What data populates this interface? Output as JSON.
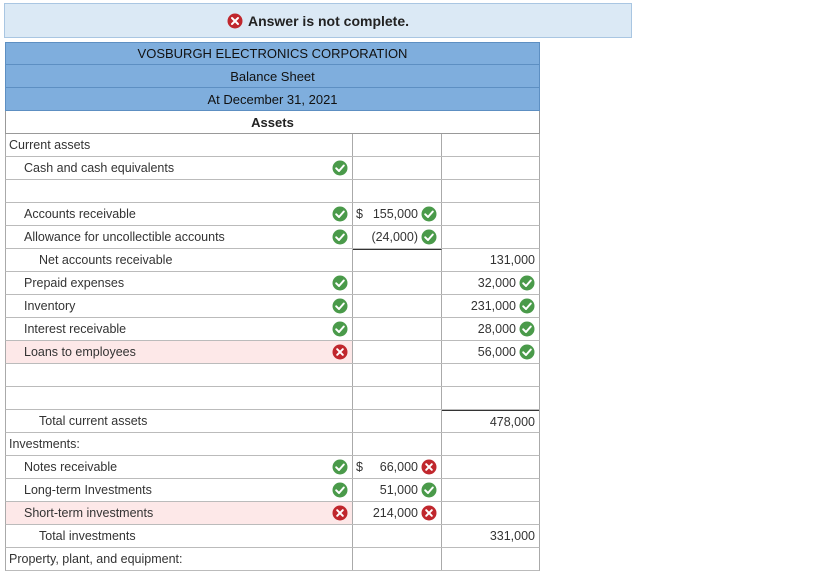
{
  "banner": {
    "text": "Answer is not complete.",
    "icon": "x-circle-icon"
  },
  "header": {
    "company": "VOSBURGH ELECTRONICS CORPORATION",
    "statement": "Balance Sheet",
    "date": "At December 31, 2021",
    "section": "Assets"
  },
  "rows": [
    {
      "label": "Current assets",
      "indent": 0
    },
    {
      "label": "Cash and cash equivalents",
      "indent": 1,
      "status": "correct"
    },
    {
      "label": "",
      "indent": 1
    },
    {
      "label": "Accounts receivable",
      "indent": 1,
      "status": "correct",
      "dollar": "$",
      "col2": "155,000",
      "col2_status": "correct"
    },
    {
      "label": "Allowance for uncollectible accounts",
      "indent": 1,
      "status": "correct",
      "col2": "(24,000)",
      "col2_status": "correct"
    },
    {
      "label": "Net accounts receivable",
      "indent": 2,
      "col3": "131,000"
    },
    {
      "label": "Prepaid expenses",
      "indent": 1,
      "status": "correct",
      "col3": "32,000",
      "col3_status": "correct"
    },
    {
      "label": "Inventory",
      "indent": 1,
      "status": "correct",
      "col3": "231,000",
      "col3_status": "correct"
    },
    {
      "label": "Interest receivable",
      "indent": 1,
      "status": "correct",
      "col3": "28,000",
      "col3_status": "correct"
    },
    {
      "label": "Loans to employees",
      "indent": 1,
      "status": "incorrect",
      "col3": "56,000",
      "col3_status": "correct"
    },
    {
      "label": "",
      "indent": 1
    },
    {
      "label": "",
      "indent": 1
    },
    {
      "label": "Total current assets",
      "indent": 2,
      "col3": "478,000"
    },
    {
      "label": "Investments:",
      "indent": 0
    },
    {
      "label": "Notes receivable",
      "indent": 1,
      "status": "correct",
      "dollar": "$",
      "col2": "66,000",
      "col2_status": "incorrect"
    },
    {
      "label": "Long-term Investments",
      "indent": 1,
      "status": "correct",
      "col2": "51,000",
      "col2_status": "correct"
    },
    {
      "label": "Short-term investments",
      "indent": 1,
      "status": "incorrect",
      "col2": "214,000",
      "col2_status": "incorrect"
    },
    {
      "label": "Total investments",
      "indent": 2,
      "col3": "331,000"
    },
    {
      "label": "Property, plant, and equipment:",
      "indent": 0
    }
  ],
  "colors": {
    "correct": "#4a9a4a",
    "incorrect": "#c0272d",
    "header_bg": "#7faedd",
    "banner_bg": "#dbe9f5",
    "error_row_bg": "#fde8e8"
  }
}
